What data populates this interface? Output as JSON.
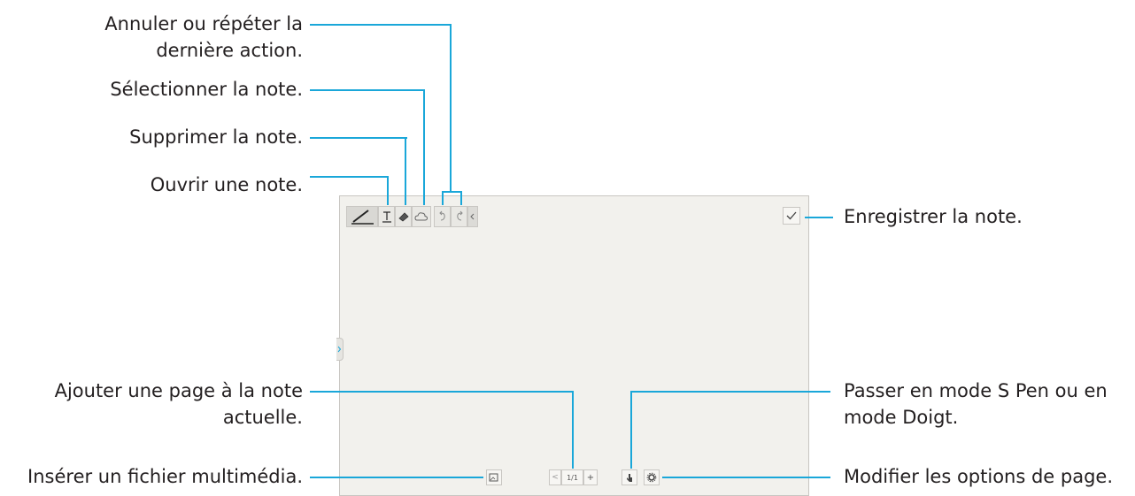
{
  "annotations": {
    "undo_redo": [
      "Annuler ou répéter la",
      "dernière action."
    ],
    "select_note": "Sélectionner la note.",
    "delete_note": "Supprimer la note.",
    "open_note": "Ouvrir une note.",
    "save_note": "Enregistrer la note.",
    "add_page": [
      "Ajouter une page à la note",
      "actuelle."
    ],
    "insert_media": "Insérer un fichier multimédia.",
    "pen_finger_mode": [
      "Passer en mode S Pen ou en",
      "mode Doigt."
    ],
    "page_options": "Modifier les options de page."
  },
  "toolbar": {
    "icons": [
      "pen-icon",
      "text-icon",
      "eraser-icon",
      "cloud-icon",
      "undo-icon",
      "redo-icon",
      "collapse-chevron-icon"
    ],
    "save_icon": "checkmark-icon"
  },
  "bottom_bar": {
    "page_indicator": "1/1",
    "add_page_symbol": "+",
    "prev_symbol": "<",
    "icons": [
      "media-icon",
      "finger-mode-icon",
      "settings-gear-icon"
    ]
  },
  "colors": {
    "callout_line": "#1aa7d9",
    "canvas": "#f2f1ed",
    "text": "#231f20"
  }
}
